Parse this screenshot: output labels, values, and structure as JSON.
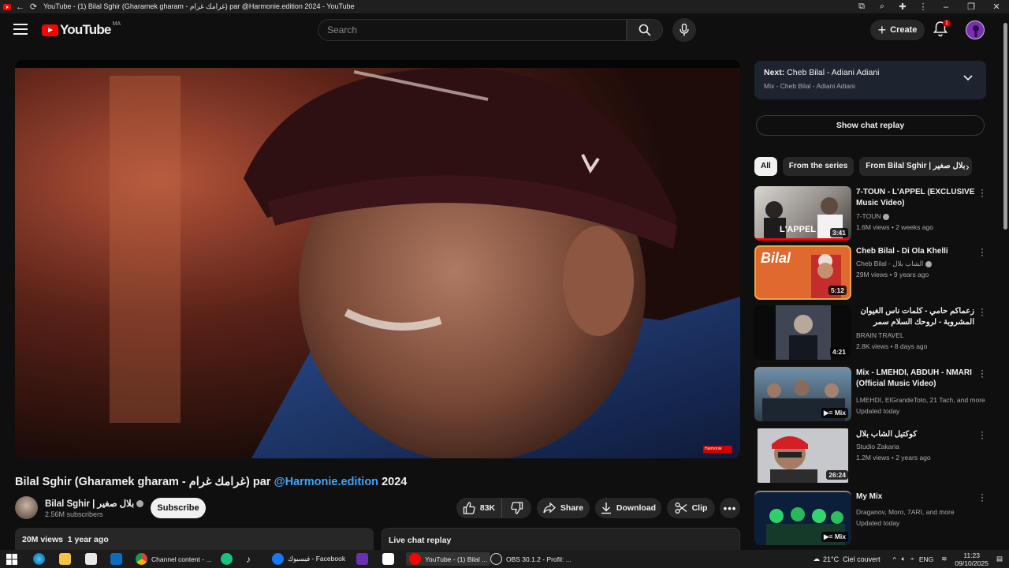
{
  "browser": {
    "tab_title": "YouTube - (1) Bilal Sghir (Gharamek gharam - غرامك غرام) par @Harmonie.edition 2024 - YouTube"
  },
  "header": {
    "logo_text": "YouTube",
    "country_code": "MA",
    "search_placeholder": "Search",
    "create_label": "Create",
    "notification_count": "1"
  },
  "video": {
    "title_main": "Bilal Sghir (Gharamek gharam - غرامك غرام) par ",
    "title_handle": "@Harmonie.edition",
    "title_year": " 2024",
    "watermark": "Harmonie"
  },
  "channel": {
    "name": "Bilal Sghir | بلال صغير",
    "subscribers": "2.56M subscribers",
    "subscribe_label": "Subscribe"
  },
  "actions": {
    "likes": "83K",
    "share": "Share",
    "download": "Download",
    "clip": "Clip"
  },
  "description": {
    "stats": "20M views  1 year ago"
  },
  "live_chat": {
    "label": "Live chat replay",
    "show_label": "Show chat replay"
  },
  "up_next": {
    "prefix": "Next:",
    "title": " Cheb Bilal - Adiani Adiani",
    "subtitle": "Mix - Cheb Bilal - Adiani Adiani"
  },
  "chips": [
    "All",
    "From the series",
    "From Bilal Sghir | بلال صغير"
  ],
  "recommendations": [
    {
      "title": "7-TOUN - L'APPEL (EXCLUSIVE Music Video)",
      "channel": "7-TOUN",
      "meta": "1.6M views • 2 weeks ago",
      "duration": "3:41",
      "thumb_text": "L'APPEL",
      "verified": true
    },
    {
      "title": "Cheb Bilal - Di Ola Khelli",
      "channel": "Cheb Bilal - الشاب بلال",
      "meta": "29M views • 9 years ago",
      "duration": "5:12",
      "thumb_text": "Bilal",
      "verified": true
    },
    {
      "title": "زعماكم حامي - كلمات ناس الغيوان المشروبة - لروحك السلام سمر",
      "channel": "BRAIN TRAVEL",
      "meta": "2.8K views • 8 days ago",
      "duration": "4:21",
      "thumb_text": "",
      "verified": false
    },
    {
      "title": "Mix - LMEHDI, ABDUH - NMARI (Official Music Video)",
      "channel": "LMEHDI, ElGrandeToto, 21 Tach, and more",
      "meta": "Updated today",
      "duration": "Mix",
      "thumb_text": "",
      "verified": false
    },
    {
      "title": "كوكتيل الشاب بلال",
      "channel": "Studio Zakaria",
      "meta": "1.2M views • 2 years ago",
      "duration": "26:24",
      "thumb_text": "",
      "verified": false
    },
    {
      "title": "My Mix",
      "channel": "Draganov, Moro, 7ARI, and more",
      "meta": "Updated today",
      "duration": "Mix",
      "thumb_text": "",
      "verified": false
    }
  ],
  "taskbar": {
    "items": [
      "Channel content - ...",
      "فيسبوك - Facebook",
      "YouTube - (1) Bilal ...",
      "OBS 30.1.2 - Profil: ..."
    ],
    "weather": "21°C  Ciel couvert",
    "lang": "ENG",
    "time": "11:23",
    "date": "09/10/2025"
  },
  "colors": {
    "accent": "#ff0000",
    "link": "#3ea6ff",
    "background": "#0f0f0f"
  }
}
